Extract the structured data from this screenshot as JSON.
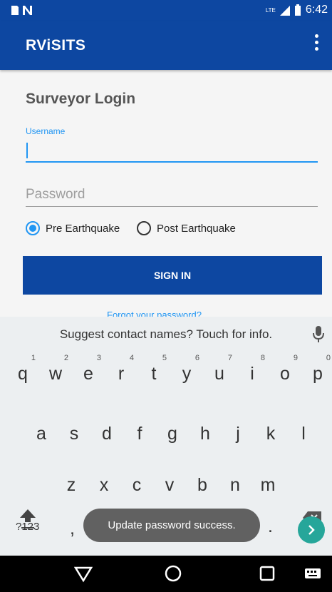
{
  "status_bar": {
    "network": "LTE",
    "time": "6:42"
  },
  "app_bar": {
    "title": "RViSITS",
    "overflow_icon": "more-vert-icon"
  },
  "login": {
    "title": "Surveyor Login",
    "username_label": "Username",
    "username_value": "",
    "password_placeholder": "Password",
    "radio_options": [
      {
        "label": "Pre Earthquake",
        "selected": true
      },
      {
        "label": "Post Earthquake",
        "selected": false
      }
    ],
    "sign_in_label": "SIGN IN",
    "forgot_label": "Forgot your password?"
  },
  "keyboard": {
    "suggestion": "Suggest contact names? Touch for info.",
    "row1": [
      {
        "k": "q",
        "n": "1"
      },
      {
        "k": "w",
        "n": "2"
      },
      {
        "k": "e",
        "n": "3"
      },
      {
        "k": "r",
        "n": "4"
      },
      {
        "k": "t",
        "n": "5"
      },
      {
        "k": "y",
        "n": "6"
      },
      {
        "k": "u",
        "n": "7"
      },
      {
        "k": "i",
        "n": "8"
      },
      {
        "k": "o",
        "n": "9"
      },
      {
        "k": "p",
        "n": "0"
      }
    ],
    "row2": [
      "a",
      "s",
      "d",
      "f",
      "g",
      "h",
      "j",
      "k",
      "l"
    ],
    "row3": [
      "z",
      "x",
      "c",
      "v",
      "b",
      "n",
      "m"
    ],
    "symbols_key": "?123",
    "comma": ",",
    "period": "."
  },
  "toast": "Update password success.",
  "colors": {
    "primary": "#0d47a1",
    "accent": "#2196f3",
    "enter": "#26a69a"
  }
}
